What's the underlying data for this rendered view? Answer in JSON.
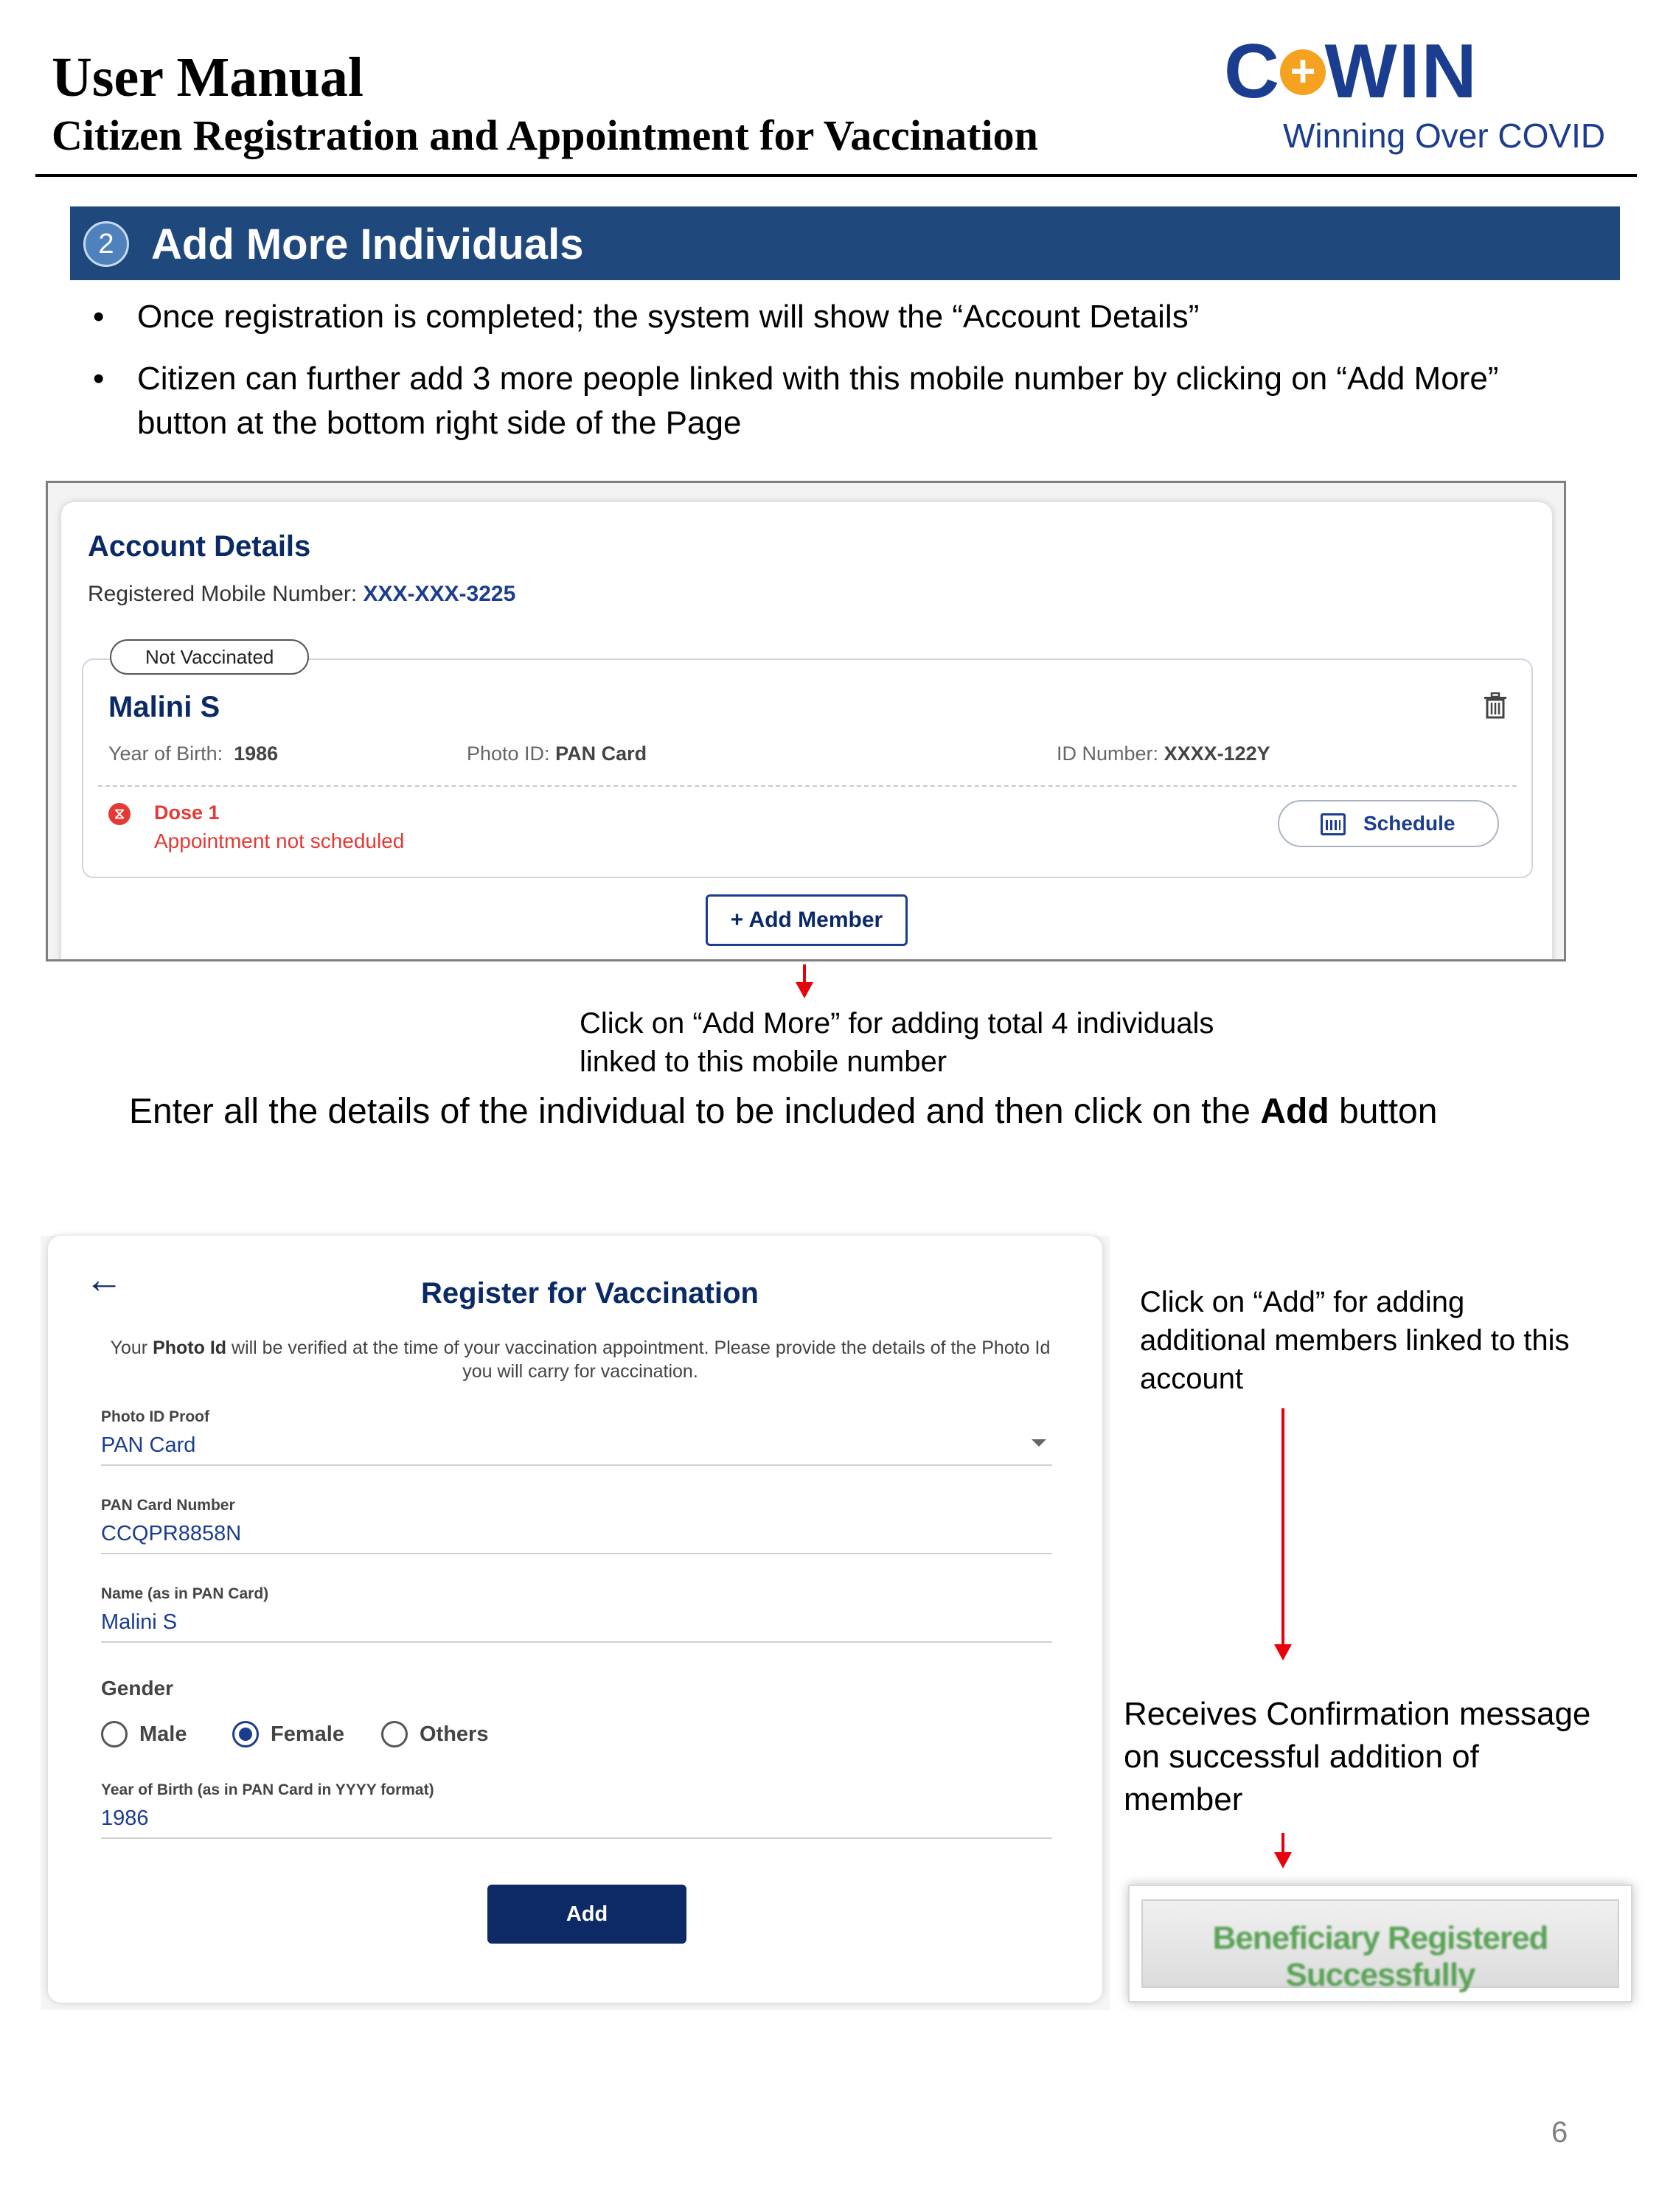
{
  "header": {
    "title": "User Manual",
    "subtitle": "Citizen Registration and Appointment for Vaccination",
    "logo_word": "C -WIN",
    "logo_tagline": "Winning Over COVID"
  },
  "section": {
    "number": "2",
    "title": "Add More Individuals",
    "bullets": [
      "Once registration is completed; the system will show the “Account Details”",
      "Citizen can further add 3 more people linked with this mobile number by clicking on “Add More” button at the bottom right side of the Page"
    ]
  },
  "account_details": {
    "title": "Account Details",
    "mobile_label": "Registered Mobile Number:",
    "mobile_value": "XXX-XXX-3225",
    "member": {
      "status_pill": "Not Vaccinated",
      "name": "Malini S",
      "yob_label": "Year of Birth:",
      "yob_value": "1986",
      "photo_id_label": "Photo ID:",
      "photo_id_value": "PAN Card",
      "id_number_label": "ID Number:",
      "id_number_value": "XXXX-122Y",
      "dose_label": "Dose 1",
      "dose_status": "Appointment not scheduled",
      "schedule_label": "Schedule"
    },
    "add_member_label": "+ Add Member"
  },
  "callouts": {
    "add_more_note": "Click on “Add More” for adding total 4 individuals linked to this mobile number",
    "instruction_pre": "Enter all the details of the individual to be included and then click on the ",
    "instruction_bold": "Add",
    "instruction_post": " button",
    "add_note": "Click on “Add” for adding additional members linked to this account",
    "confirm_note": "Receives Confirmation message on successful addition of member",
    "toast_text": "Beneficiary Registered Successfully"
  },
  "register_form": {
    "title": "Register for Vaccination",
    "note_pre": "Your ",
    "note_bold": "Photo Id",
    "note_post": " will be verified at the time of your vaccination appointment. Please provide the details of the Photo Id you will carry for vaccination.",
    "fields": [
      {
        "label": "Photo ID Proof",
        "value": "PAN Card"
      },
      {
        "label": "PAN Card Number",
        "value": "CCQPR8858N"
      },
      {
        "label": "Name (as in PAN Card)",
        "value": "Malini S"
      },
      {
        "label": "Year of Birth (as in PAN Card in YYYY format)",
        "value": "1986"
      }
    ],
    "gender_label": "Gender",
    "gender_options": [
      "Male",
      "Female",
      "Others"
    ],
    "gender_selected": "Female",
    "add_label": "Add"
  },
  "page_number": "6",
  "colors": {
    "banner": "#1f497d",
    "brand_navy": "#0a2a66",
    "alert_red": "#e53935",
    "arrow_red": "#e8000b",
    "success_green": "#5aa357"
  }
}
